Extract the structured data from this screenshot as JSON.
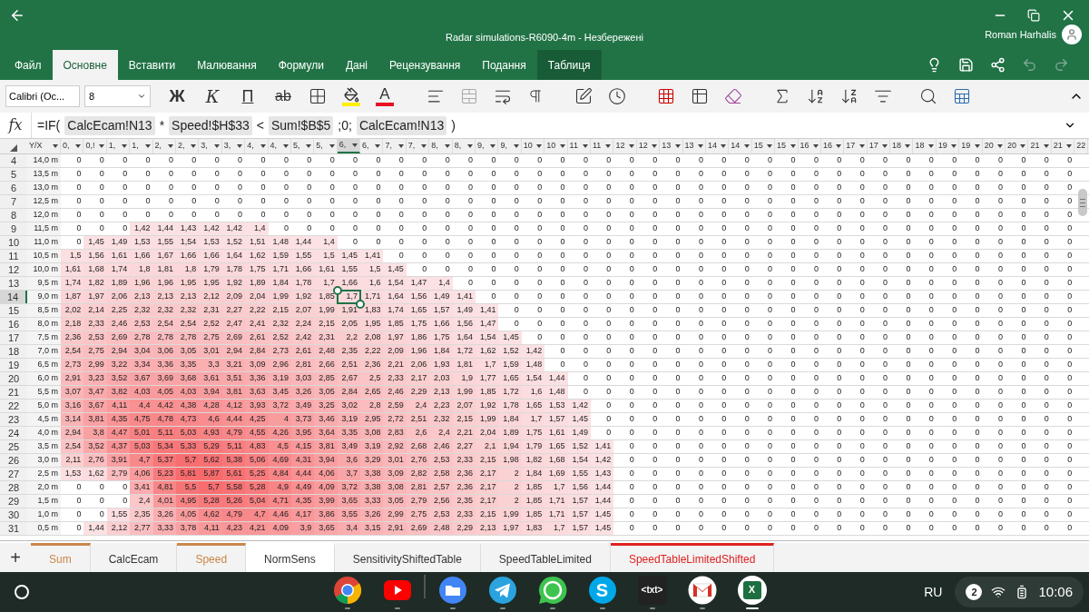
{
  "window": {
    "title": "Radar simulations-R6090-4m - Незбережені",
    "user": "Roman Harhalis"
  },
  "ribbon_tabs": [
    {
      "label": "Файл",
      "selected": false,
      "kind": "normal"
    },
    {
      "label": "Основне",
      "selected": true,
      "kind": "normal"
    },
    {
      "label": "Вставити",
      "selected": false,
      "kind": "normal"
    },
    {
      "label": "Малювання",
      "selected": false,
      "kind": "normal"
    },
    {
      "label": "Формули",
      "selected": false,
      "kind": "normal"
    },
    {
      "label": "Дані",
      "selected": false,
      "kind": "normal"
    },
    {
      "label": "Рецензування",
      "selected": false,
      "kind": "normal"
    },
    {
      "label": "Подання",
      "selected": false,
      "kind": "normal"
    },
    {
      "label": "Таблиця",
      "selected": false,
      "kind": "contextual"
    }
  ],
  "toolbar": {
    "font": "Calibri (Ос...",
    "size": "8",
    "format_buttons": [
      {
        "label": "Ж",
        "kind": "bold"
      },
      {
        "label": "К",
        "kind": "italic"
      },
      {
        "label": "П",
        "kind": "underline"
      },
      {
        "label": "ab",
        "kind": "strike"
      }
    ],
    "font_color_label": "A"
  },
  "formula_bar": {
    "label": "fx",
    "parts": [
      {
        "text": "=IF(",
        "kind": "plain"
      },
      {
        "text": "CalcEcam!N13",
        "kind": "ref"
      },
      {
        "text": "*",
        "kind": "plain"
      },
      {
        "text": "Speed!$H$33",
        "kind": "ref"
      },
      {
        "text": "<",
        "kind": "plain"
      },
      {
        "text": "Sum!$B$5",
        "kind": "ref"
      },
      {
        "text": ";0;",
        "kind": "plain"
      },
      {
        "text": "CalcEcam!N13",
        "kind": "ref"
      },
      {
        "text": ")",
        "kind": "plain"
      }
    ]
  },
  "table": {
    "columns": [
      {
        "label": "Y/X",
        "selected": false
      },
      {
        "label": "0,",
        "selected": false
      },
      {
        "label": "0,!",
        "selected": false
      },
      {
        "label": "1,",
        "selected": false
      },
      {
        "label": "1,",
        "selected": false
      },
      {
        "label": "2,",
        "selected": false
      },
      {
        "label": "2,",
        "selected": false
      },
      {
        "label": "3,",
        "selected": false
      },
      {
        "label": "3,",
        "selected": false
      },
      {
        "label": "4,",
        "selected": false
      },
      {
        "label": "4,",
        "selected": false
      },
      {
        "label": "5,",
        "selected": false
      },
      {
        "label": "5,",
        "selected": false
      },
      {
        "label": "6,",
        "selected": true
      },
      {
        "label": "6,",
        "selected": false
      },
      {
        "label": "7,",
        "selected": false
      },
      {
        "label": "7,",
        "selected": false
      },
      {
        "label": "8,",
        "selected": false
      },
      {
        "label": "8,",
        "selected": false
      },
      {
        "label": "9,",
        "selected": false
      },
      {
        "label": "9,",
        "selected": false
      },
      {
        "label": "10",
        "selected": false
      },
      {
        "label": "10",
        "selected": false
      },
      {
        "label": "11",
        "selected": false
      },
      {
        "label": "11",
        "selected": false
      },
      {
        "label": "12",
        "selected": false
      },
      {
        "label": "12",
        "selected": false
      },
      {
        "label": "13",
        "selected": false
      },
      {
        "label": "13",
        "selected": false
      },
      {
        "label": "14",
        "selected": false
      },
      {
        "label": "14",
        "selected": false
      },
      {
        "label": "15",
        "selected": false
      },
      {
        "label": "15",
        "selected": false
      },
      {
        "label": "16",
        "selected": false
      },
      {
        "label": "16",
        "selected": false
      },
      {
        "label": "17",
        "selected": false
      },
      {
        "label": "17",
        "selected": false
      },
      {
        "label": "18",
        "selected": false
      },
      {
        "label": "18",
        "selected": false
      },
      {
        "label": "19",
        "selected": false
      },
      {
        "label": "19",
        "selected": false
      },
      {
        "label": "20",
        "selected": false
      },
      {
        "label": "20",
        "selected": false
      },
      {
        "label": "21",
        "selected": false
      },
      {
        "label": "21",
        "selected": false
      },
      {
        "label": "22",
        "selected": false
      }
    ],
    "rows": [
      {
        "number": "4",
        "selected": false,
        "cells": [
          "14,0 m",
          "0",
          "0",
          "0",
          "0",
          "0",
          "0",
          "0",
          "0",
          "0",
          "0",
          "0",
          "0",
          "0",
          "0",
          "0",
          "0",
          "0",
          "0",
          "0",
          "0",
          "0",
          "0",
          "0",
          "0",
          "0",
          "0",
          "0",
          "0",
          "0",
          "0",
          "0",
          "0",
          "0",
          "0",
          "0",
          "0",
          "0",
          "0",
          "0",
          "0",
          "0",
          "0",
          "0",
          "0"
        ]
      },
      {
        "number": "5",
        "selected": false,
        "cells": [
          "13,5 m",
          "0",
          "0",
          "0",
          "0",
          "0",
          "0",
          "0",
          "0",
          "0",
          "0",
          "0",
          "0",
          "0",
          "0",
          "0",
          "0",
          "0",
          "0",
          "0",
          "0",
          "0",
          "0",
          "0",
          "0",
          "0",
          "0",
          "0",
          "0",
          "0",
          "0",
          "0",
          "0",
          "0",
          "0",
          "0",
          "0",
          "0",
          "0",
          "0",
          "0",
          "0",
          "0",
          "0",
          "0"
        ]
      },
      {
        "number": "6",
        "selected": false,
        "cells": [
          "13,0 m",
          "0",
          "0",
          "0",
          "0",
          "0",
          "0",
          "0",
          "0",
          "0",
          "0",
          "0",
          "0",
          "0",
          "0",
          "0",
          "0",
          "0",
          "0",
          "0",
          "0",
          "0",
          "0",
          "0",
          "0",
          "0",
          "0",
          "0",
          "0",
          "0",
          "0",
          "0",
          "0",
          "0",
          "0",
          "0",
          "0",
          "0",
          "0",
          "0",
          "0",
          "0",
          "0",
          "0",
          "0"
        ]
      },
      {
        "number": "7",
        "selected": false,
        "cells": [
          "12,5 m",
          "0",
          "0",
          "0",
          "0",
          "0",
          "0",
          "0",
          "0",
          "0",
          "0",
          "0",
          "0",
          "0",
          "0",
          "0",
          "0",
          "0",
          "0",
          "0",
          "0",
          "0",
          "0",
          "0",
          "0",
          "0",
          "0",
          "0",
          "0",
          "0",
          "0",
          "0",
          "0",
          "0",
          "0",
          "0",
          "0",
          "0",
          "0",
          "0",
          "0",
          "0",
          "0",
          "0",
          "0"
        ]
      },
      {
        "number": "8",
        "selected": false,
        "cells": [
          "12,0 m",
          "0",
          "0",
          "0",
          "0",
          "0",
          "0",
          "0",
          "0",
          "0",
          "0",
          "0",
          "0",
          "0",
          "0",
          "0",
          "0",
          "0",
          "0",
          "0",
          "0",
          "0",
          "0",
          "0",
          "0",
          "0",
          "0",
          "0",
          "0",
          "0",
          "0",
          "0",
          "0",
          "0",
          "0",
          "0",
          "0",
          "0",
          "0",
          "0",
          "0",
          "0",
          "0",
          "0",
          "0"
        ]
      },
      {
        "number": "9",
        "selected": false,
        "cells": [
          "11,5 m",
          "0",
          "0",
          "0",
          "1,42",
          "1,44",
          "1,43",
          "1,42",
          "1,42",
          "1,4",
          "0",
          "0",
          "0",
          "0",
          "0",
          "0",
          "0",
          "0",
          "0",
          "0",
          "0",
          "0",
          "0",
          "0",
          "0",
          "0",
          "0",
          "0",
          "0",
          "0",
          "0",
          "0",
          "0",
          "0",
          "0",
          "0",
          "0",
          "0",
          "0",
          "0",
          "0",
          "0",
          "0",
          "0",
          "0"
        ]
      },
      {
        "number": "10",
        "selected": false,
        "cells": [
          "11,0 m",
          "0",
          "1,45",
          "1,49",
          "1,53",
          "1,55",
          "1,54",
          "1,53",
          "1,52",
          "1,51",
          "1,48",
          "1,44",
          "1,4",
          "0",
          "0",
          "0",
          "0",
          "0",
          "0",
          "0",
          "0",
          "0",
          "0",
          "0",
          "0",
          "0",
          "0",
          "0",
          "0",
          "0",
          "0",
          "0",
          "0",
          "0",
          "0",
          "0",
          "0",
          "0",
          "0",
          "0",
          "0",
          "0",
          "0",
          "0",
          "0"
        ]
      },
      {
        "number": "11",
        "selected": false,
        "cells": [
          "10,5 m",
          "1,5",
          "1,56",
          "1,61",
          "1,66",
          "1,67",
          "1,66",
          "1,66",
          "1,64",
          "1,62",
          "1,59",
          "1,55",
          "1,5",
          "1,45",
          "1,41",
          "0",
          "0",
          "0",
          "0",
          "0",
          "0",
          "0",
          "0",
          "0",
          "0",
          "0",
          "0",
          "0",
          "0",
          "0",
          "0",
          "0",
          "0",
          "0",
          "0",
          "0",
          "0",
          "0",
          "0",
          "0",
          "0",
          "0",
          "0",
          "0",
          "0"
        ]
      },
      {
        "number": "12",
        "selected": false,
        "cells": [
          "10,0 m",
          "1,61",
          "1,68",
          "1,74",
          "1,8",
          "1,81",
          "1,8",
          "1,79",
          "1,78",
          "1,75",
          "1,71",
          "1,66",
          "1,61",
          "1,55",
          "1,5",
          "1,45",
          "0",
          "0",
          "0",
          "0",
          "0",
          "0",
          "0",
          "0",
          "0",
          "0",
          "0",
          "0",
          "0",
          "0",
          "0",
          "0",
          "0",
          "0",
          "0",
          "0",
          "0",
          "0",
          "0",
          "0",
          "0",
          "0",
          "0",
          "0",
          "0"
        ]
      },
      {
        "number": "13",
        "selected": false,
        "cells": [
          "9,5 m",
          "1,74",
          "1,82",
          "1,89",
          "1,96",
          "1,96",
          "1,95",
          "1,95",
          "1,92",
          "1,89",
          "1,84",
          "1,78",
          "1,7",
          "1,66",
          "1,6",
          "1,54",
          "1,47",
          "1,4",
          "0",
          "0",
          "0",
          "0",
          "0",
          "0",
          "0",
          "0",
          "0",
          "0",
          "0",
          "0",
          "0",
          "0",
          "0",
          "0",
          "0",
          "0",
          "0",
          "0",
          "0",
          "0",
          "0",
          "0",
          "0",
          "0",
          "0"
        ]
      },
      {
        "number": "14",
        "selected": true,
        "cells": [
          "9,0 m",
          "1,87",
          "1,97",
          "2,06",
          "2,13",
          "2,13",
          "2,13",
          "2,12",
          "2,09",
          "2,04",
          "1,99",
          "1,92",
          "1,85",
          "1,7",
          "1,71",
          "1,64",
          "1,56",
          "1,49",
          "1,41",
          "0",
          "0",
          "0",
          "0",
          "0",
          "0",
          "0",
          "0",
          "0",
          "0",
          "0",
          "0",
          "0",
          "0",
          "0",
          "0",
          "0",
          "0",
          "0",
          "0",
          "0",
          "0",
          "0",
          "0",
          "0",
          "0"
        ]
      },
      {
        "number": "15",
        "selected": false,
        "cells": [
          "8,5 m",
          "2,02",
          "2,14",
          "2,25",
          "2,32",
          "2,32",
          "2,32",
          "2,31",
          "2,27",
          "2,22",
          "2,15",
          "2,07",
          "1,99",
          "1,91",
          "1,83",
          "1,74",
          "1,65",
          "1,57",
          "1,49",
          "1,41",
          "0",
          "0",
          "0",
          "0",
          "0",
          "0",
          "0",
          "0",
          "0",
          "0",
          "0",
          "0",
          "0",
          "0",
          "0",
          "0",
          "0",
          "0",
          "0",
          "0",
          "0",
          "0",
          "0",
          "0",
          "0"
        ]
      },
      {
        "number": "16",
        "selected": false,
        "cells": [
          "8,0 m",
          "2,18",
          "2,33",
          "2,46",
          "2,53",
          "2,54",
          "2,54",
          "2,52",
          "2,47",
          "2,41",
          "2,32",
          "2,24",
          "2,15",
          "2,05",
          "1,95",
          "1,85",
          "1,75",
          "1,66",
          "1,56",
          "1,47",
          "0",
          "0",
          "0",
          "0",
          "0",
          "0",
          "0",
          "0",
          "0",
          "0",
          "0",
          "0",
          "0",
          "0",
          "0",
          "0",
          "0",
          "0",
          "0",
          "0",
          "0",
          "0",
          "0",
          "0",
          "0"
        ]
      },
      {
        "number": "17",
        "selected": false,
        "cells": [
          "7,5 m",
          "2,36",
          "2,53",
          "2,69",
          "2,78",
          "2,78",
          "2,78",
          "2,75",
          "2,69",
          "2,61",
          "2,52",
          "2,42",
          "2,31",
          "2,2",
          "2,08",
          "1,97",
          "1,86",
          "1,75",
          "1,64",
          "1,54",
          "1,45",
          "0",
          "0",
          "0",
          "0",
          "0",
          "0",
          "0",
          "0",
          "0",
          "0",
          "0",
          "0",
          "0",
          "0",
          "0",
          "0",
          "0",
          "0",
          "0",
          "0",
          "0",
          "0",
          "0",
          "0"
        ]
      },
      {
        "number": "18",
        "selected": false,
        "cells": [
          "7,0 m",
          "2,54",
          "2,75",
          "2,94",
          "3,04",
          "3,06",
          "3,05",
          "3,01",
          "2,94",
          "2,84",
          "2,73",
          "2,61",
          "2,48",
          "2,35",
          "2,22",
          "2,09",
          "1,96",
          "1,84",
          "1,72",
          "1,62",
          "1,52",
          "1,42",
          "0",
          "0",
          "0",
          "0",
          "0",
          "0",
          "0",
          "0",
          "0",
          "0",
          "0",
          "0",
          "0",
          "0",
          "0",
          "0",
          "0",
          "0",
          "0",
          "0",
          "0",
          "0",
          "0"
        ]
      },
      {
        "number": "19",
        "selected": false,
        "cells": [
          "6,5 m",
          "2,73",
          "2,99",
          "3,22",
          "3,34",
          "3,36",
          "3,35",
          "3,3",
          "3,21",
          "3,09",
          "2,96",
          "2,81",
          "2,66",
          "2,51",
          "2,36",
          "2,21",
          "2,06",
          "1,93",
          "1,81",
          "1,7",
          "1,59",
          "1,48",
          "0",
          "0",
          "0",
          "0",
          "0",
          "0",
          "0",
          "0",
          "0",
          "0",
          "0",
          "0",
          "0",
          "0",
          "0",
          "0",
          "0",
          "0",
          "0",
          "0",
          "0",
          "0",
          "0"
        ]
      },
      {
        "number": "20",
        "selected": false,
        "cells": [
          "6,0 m",
          "2,91",
          "3,23",
          "3,52",
          "3,67",
          "3,69",
          "3,68",
          "3,61",
          "3,51",
          "3,36",
          "3,19",
          "3,03",
          "2,85",
          "2,67",
          "2,5",
          "2,33",
          "2,17",
          "2,03",
          "1,9",
          "1,77",
          "1,65",
          "1,54",
          "1,44",
          "0",
          "0",
          "0",
          "0",
          "0",
          "0",
          "0",
          "0",
          "0",
          "0",
          "0",
          "0",
          "0",
          "0",
          "0",
          "0",
          "0",
          "0",
          "0",
          "0",
          "0",
          "0"
        ]
      },
      {
        "number": "21",
        "selected": false,
        "cells": [
          "5,5 m",
          "3,07",
          "3,47",
          "3,82",
          "4,03",
          "4,05",
          "4,03",
          "3,94",
          "3,81",
          "3,63",
          "3,45",
          "3,26",
          "3,05",
          "2,84",
          "2,65",
          "2,46",
          "2,29",
          "2,13",
          "1,99",
          "1,85",
          "1,72",
          "1,6",
          "1,48",
          "0",
          "0",
          "0",
          "0",
          "0",
          "0",
          "0",
          "0",
          "0",
          "0",
          "0",
          "0",
          "0",
          "0",
          "0",
          "0",
          "0",
          "0",
          "0",
          "0",
          "0",
          "0"
        ]
      },
      {
        "number": "22",
        "selected": false,
        "cells": [
          "5,0 m",
          "3,16",
          "3,67",
          "4,11",
          "4,4",
          "4,42",
          "4,38",
          "4,28",
          "4,12",
          "3,93",
          "3,72",
          "3,49",
          "3,25",
          "3,02",
          "2,8",
          "2,59",
          "2,4",
          "2,23",
          "2,07",
          "1,92",
          "1,78",
          "1,65",
          "1,53",
          "1,42",
          "0",
          "0",
          "0",
          "0",
          "0",
          "0",
          "0",
          "0",
          "0",
          "0",
          "0",
          "0",
          "0",
          "0",
          "0",
          "0",
          "0",
          "0",
          "0",
          "0",
          "0"
        ]
      },
      {
        "number": "23",
        "selected": false,
        "cells": [
          "4,5 m",
          "3,14",
          "3,81",
          "4,35",
          "4,75",
          "4,78",
          "4,73",
          "4,6",
          "4,44",
          "4,25",
          "4",
          "3,73",
          "3,46",
          "3,19",
          "2,95",
          "2,72",
          "2,51",
          "2,32",
          "2,15",
          "1,99",
          "1,84",
          "1,7",
          "1,57",
          "1,45",
          "0",
          "0",
          "0",
          "0",
          "0",
          "0",
          "0",
          "0",
          "0",
          "0",
          "0",
          "0",
          "0",
          "0",
          "0",
          "0",
          "0",
          "0",
          "0",
          "0",
          "0"
        ]
      },
      {
        "number": "24",
        "selected": false,
        "cells": [
          "4,0 m",
          "2,94",
          "3,8",
          "4,47",
          "5,01",
          "5,11",
          "5,03",
          "4,93",
          "4,79",
          "4,55",
          "4,26",
          "3,95",
          "3,64",
          "3,35",
          "3,08",
          "2,83",
          "2,6",
          "2,4",
          "2,21",
          "2,04",
          "1,89",
          "1,75",
          "1,61",
          "1,49",
          "0",
          "0",
          "0",
          "0",
          "0",
          "0",
          "0",
          "0",
          "0",
          "0",
          "0",
          "0",
          "0",
          "0",
          "0",
          "0",
          "0",
          "0",
          "0",
          "0",
          "0"
        ]
      },
      {
        "number": "25",
        "selected": false,
        "cells": [
          "3,5 m",
          "2,54",
          "3,52",
          "4,37",
          "5,03",
          "5,34",
          "5,33",
          "5,29",
          "5,11",
          "4,83",
          "4,5",
          "4,15",
          "3,81",
          "3,49",
          "3,19",
          "2,92",
          "2,68",
          "2,46",
          "2,27",
          "2,1",
          "1,94",
          "1,79",
          "1,65",
          "1,52",
          "1,41",
          "0",
          "0",
          "0",
          "0",
          "0",
          "0",
          "0",
          "0",
          "0",
          "0",
          "0",
          "0",
          "0",
          "0",
          "0",
          "0",
          "0",
          "0",
          "0",
          "0"
        ]
      },
      {
        "number": "26",
        "selected": false,
        "cells": [
          "3,0 m",
          "2,11",
          "2,76",
          "3,91",
          "4,7",
          "5,37",
          "5,7",
          "5,62",
          "5,38",
          "5,06",
          "4,69",
          "4,31",
          "3,94",
          "3,6",
          "3,29",
          "3,01",
          "2,76",
          "2,53",
          "2,33",
          "2,15",
          "1,98",
          "1,82",
          "1,68",
          "1,54",
          "1,42",
          "0",
          "0",
          "0",
          "0",
          "0",
          "0",
          "0",
          "0",
          "0",
          "0",
          "0",
          "0",
          "0",
          "0",
          "0",
          "0",
          "0",
          "0",
          "0",
          "0"
        ]
      },
      {
        "number": "27",
        "selected": false,
        "cells": [
          "2,5 m",
          "1,53",
          "1,62",
          "2,79",
          "4,06",
          "5,23",
          "5,81",
          "5,87",
          "5,61",
          "5,25",
          "4,84",
          "4,44",
          "4,06",
          "3,7",
          "3,38",
          "3,09",
          "2,82",
          "2,58",
          "2,36",
          "2,17",
          "2",
          "1,84",
          "1,69",
          "1,55",
          "1,43",
          "0",
          "0",
          "0",
          "0",
          "0",
          "0",
          "0",
          "0",
          "0",
          "0",
          "0",
          "0",
          "0",
          "0",
          "0",
          "0",
          "0",
          "0",
          "0",
          "0"
        ]
      },
      {
        "number": "28",
        "selected": false,
        "cells": [
          "2,0 m",
          "0",
          "0",
          "0",
          "3,41",
          "4,81",
          "5,5",
          "5,7",
          "5,58",
          "5,28",
          "4,9",
          "4,49",
          "4,09",
          "3,72",
          "3,38",
          "3,08",
          "2,81",
          "2,57",
          "2,36",
          "2,17",
          "2",
          "1,85",
          "1,7",
          "1,56",
          "1,44",
          "0",
          "0",
          "0",
          "0",
          "0",
          "0",
          "0",
          "0",
          "0",
          "0",
          "0",
          "0",
          "0",
          "0",
          "0",
          "0",
          "0",
          "0",
          "0",
          "0"
        ]
      },
      {
        "number": "29",
        "selected": false,
        "cells": [
          "1,5 m",
          "0",
          "0",
          "0",
          "2,4",
          "4,01",
          "4,95",
          "5,28",
          "5,26",
          "5,04",
          "4,71",
          "4,35",
          "3,99",
          "3,65",
          "3,33",
          "3,05",
          "2,79",
          "2,56",
          "2,35",
          "2,17",
          "2",
          "1,85",
          "1,71",
          "1,57",
          "1,44",
          "0",
          "0",
          "0",
          "0",
          "0",
          "0",
          "0",
          "0",
          "0",
          "0",
          "0",
          "0",
          "0",
          "0",
          "0",
          "0",
          "0",
          "0",
          "0",
          "0"
        ]
      },
      {
        "number": "30",
        "selected": false,
        "cells": [
          "1,0 m",
          "0",
          "0",
          "1,55",
          "2,35",
          "3,26",
          "4,05",
          "4,62",
          "4,79",
          "4,7",
          "4,46",
          "4,17",
          "3,86",
          "3,55",
          "3,26",
          "2,99",
          "2,75",
          "2,53",
          "2,33",
          "2,15",
          "1,99",
          "1,85",
          "1,71",
          "1,57",
          "1,45",
          "0",
          "0",
          "0",
          "0",
          "0",
          "0",
          "0",
          "0",
          "0",
          "0",
          "0",
          "0",
          "0",
          "0",
          "0",
          "0",
          "0",
          "0",
          "0",
          "0"
        ]
      },
      {
        "number": "31",
        "selected": false,
        "cells": [
          "0,5 m",
          "0",
          "1,44",
          "2,12",
          "2,77",
          "3,33",
          "3,78",
          "4,11",
          "4,23",
          "4,21",
          "4,09",
          "3,9",
          "3,65",
          "3,4",
          "3,15",
          "2,91",
          "2,69",
          "2,48",
          "2,29",
          "2,13",
          "1,97",
          "1,83",
          "1,7",
          "1,57",
          "1,45",
          "0",
          "0",
          "0",
          "0",
          "0",
          "0",
          "0",
          "0",
          "0",
          "0",
          "0",
          "0",
          "0",
          "0",
          "0",
          "0",
          "0",
          "0",
          "0",
          "0"
        ]
      }
    ]
  },
  "sheet_tabs": {
    "add_label": "+",
    "tabs": [
      {
        "label": "Sum",
        "selected": false,
        "color": "#c8874a"
      },
      {
        "label": "CalcEcam",
        "selected": false
      },
      {
        "label": "Speed",
        "selected": false,
        "color": "#c8874a"
      },
      {
        "label": "NormSens",
        "selected": true
      },
      {
        "label": "SensitivityShiftedTable",
        "selected": false
      },
      {
        "label": "SpeedTableLimited",
        "selected": false
      },
      {
        "label": "SpeedTableLimitedShifted",
        "selected": false,
        "color": "#e02020"
      }
    ]
  },
  "taskbar": {
    "apps": [
      {
        "kind": "chrome",
        "active": false
      },
      {
        "kind": "youtube",
        "active": false
      },
      {
        "kind": "divider"
      },
      {
        "kind": "files",
        "active": false
      },
      {
        "kind": "telegram",
        "active": false
      },
      {
        "kind": "whatsapp",
        "active": false
      },
      {
        "kind": "skype",
        "glyph": "S",
        "active": false
      },
      {
        "kind": "txt",
        "glyph": "<txt>",
        "active": false
      },
      {
        "kind": "gmail",
        "active": false
      },
      {
        "kind": "excel",
        "glyph": "X",
        "active": true
      }
    ],
    "language": "RU",
    "notifications": "2",
    "time": "10:06"
  }
}
